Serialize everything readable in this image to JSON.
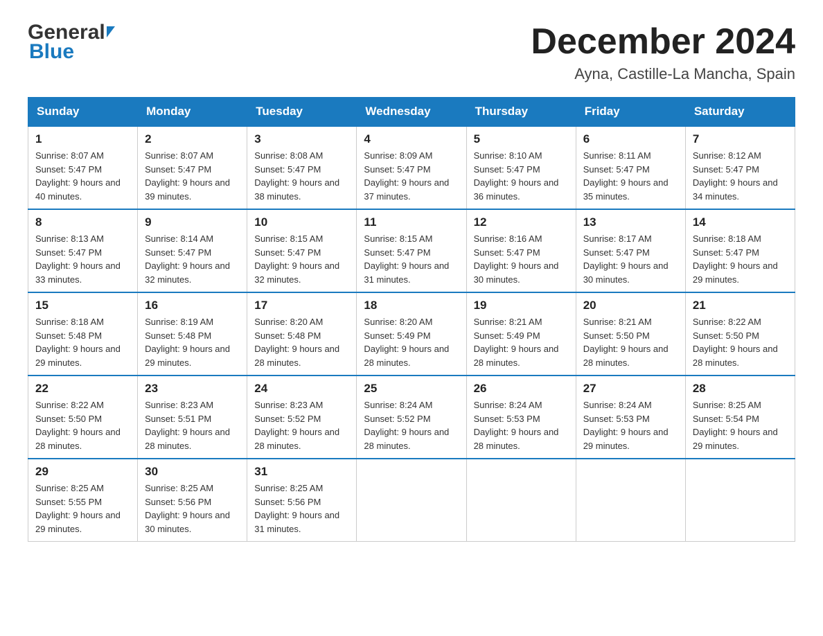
{
  "header": {
    "logo_general": "General",
    "logo_blue": "Blue",
    "month_title": "December 2024",
    "location": "Ayna, Castille-La Mancha, Spain"
  },
  "days_of_week": [
    "Sunday",
    "Monday",
    "Tuesday",
    "Wednesday",
    "Thursday",
    "Friday",
    "Saturday"
  ],
  "weeks": [
    [
      {
        "day": "1",
        "sunrise": "8:07 AM",
        "sunset": "5:47 PM",
        "daylight": "9 hours and 40 minutes."
      },
      {
        "day": "2",
        "sunrise": "8:07 AM",
        "sunset": "5:47 PM",
        "daylight": "9 hours and 39 minutes."
      },
      {
        "day": "3",
        "sunrise": "8:08 AM",
        "sunset": "5:47 PM",
        "daylight": "9 hours and 38 minutes."
      },
      {
        "day": "4",
        "sunrise": "8:09 AM",
        "sunset": "5:47 PM",
        "daylight": "9 hours and 37 minutes."
      },
      {
        "day": "5",
        "sunrise": "8:10 AM",
        "sunset": "5:47 PM",
        "daylight": "9 hours and 36 minutes."
      },
      {
        "day": "6",
        "sunrise": "8:11 AM",
        "sunset": "5:47 PM",
        "daylight": "9 hours and 35 minutes."
      },
      {
        "day": "7",
        "sunrise": "8:12 AM",
        "sunset": "5:47 PM",
        "daylight": "9 hours and 34 minutes."
      }
    ],
    [
      {
        "day": "8",
        "sunrise": "8:13 AM",
        "sunset": "5:47 PM",
        "daylight": "9 hours and 33 minutes."
      },
      {
        "day": "9",
        "sunrise": "8:14 AM",
        "sunset": "5:47 PM",
        "daylight": "9 hours and 32 minutes."
      },
      {
        "day": "10",
        "sunrise": "8:15 AM",
        "sunset": "5:47 PM",
        "daylight": "9 hours and 32 minutes."
      },
      {
        "day": "11",
        "sunrise": "8:15 AM",
        "sunset": "5:47 PM",
        "daylight": "9 hours and 31 minutes."
      },
      {
        "day": "12",
        "sunrise": "8:16 AM",
        "sunset": "5:47 PM",
        "daylight": "9 hours and 30 minutes."
      },
      {
        "day": "13",
        "sunrise": "8:17 AM",
        "sunset": "5:47 PM",
        "daylight": "9 hours and 30 minutes."
      },
      {
        "day": "14",
        "sunrise": "8:18 AM",
        "sunset": "5:47 PM",
        "daylight": "9 hours and 29 minutes."
      }
    ],
    [
      {
        "day": "15",
        "sunrise": "8:18 AM",
        "sunset": "5:48 PM",
        "daylight": "9 hours and 29 minutes."
      },
      {
        "day": "16",
        "sunrise": "8:19 AM",
        "sunset": "5:48 PM",
        "daylight": "9 hours and 29 minutes."
      },
      {
        "day": "17",
        "sunrise": "8:20 AM",
        "sunset": "5:48 PM",
        "daylight": "9 hours and 28 minutes."
      },
      {
        "day": "18",
        "sunrise": "8:20 AM",
        "sunset": "5:49 PM",
        "daylight": "9 hours and 28 minutes."
      },
      {
        "day": "19",
        "sunrise": "8:21 AM",
        "sunset": "5:49 PM",
        "daylight": "9 hours and 28 minutes."
      },
      {
        "day": "20",
        "sunrise": "8:21 AM",
        "sunset": "5:50 PM",
        "daylight": "9 hours and 28 minutes."
      },
      {
        "day": "21",
        "sunrise": "8:22 AM",
        "sunset": "5:50 PM",
        "daylight": "9 hours and 28 minutes."
      }
    ],
    [
      {
        "day": "22",
        "sunrise": "8:22 AM",
        "sunset": "5:50 PM",
        "daylight": "9 hours and 28 minutes."
      },
      {
        "day": "23",
        "sunrise": "8:23 AM",
        "sunset": "5:51 PM",
        "daylight": "9 hours and 28 minutes."
      },
      {
        "day": "24",
        "sunrise": "8:23 AM",
        "sunset": "5:52 PM",
        "daylight": "9 hours and 28 minutes."
      },
      {
        "day": "25",
        "sunrise": "8:24 AM",
        "sunset": "5:52 PM",
        "daylight": "9 hours and 28 minutes."
      },
      {
        "day": "26",
        "sunrise": "8:24 AM",
        "sunset": "5:53 PM",
        "daylight": "9 hours and 28 minutes."
      },
      {
        "day": "27",
        "sunrise": "8:24 AM",
        "sunset": "5:53 PM",
        "daylight": "9 hours and 29 minutes."
      },
      {
        "day": "28",
        "sunrise": "8:25 AM",
        "sunset": "5:54 PM",
        "daylight": "9 hours and 29 minutes."
      }
    ],
    [
      {
        "day": "29",
        "sunrise": "8:25 AM",
        "sunset": "5:55 PM",
        "daylight": "9 hours and 29 minutes."
      },
      {
        "day": "30",
        "sunrise": "8:25 AM",
        "sunset": "5:56 PM",
        "daylight": "9 hours and 30 minutes."
      },
      {
        "day": "31",
        "sunrise": "8:25 AM",
        "sunset": "5:56 PM",
        "daylight": "9 hours and 31 minutes."
      },
      null,
      null,
      null,
      null
    ]
  ]
}
